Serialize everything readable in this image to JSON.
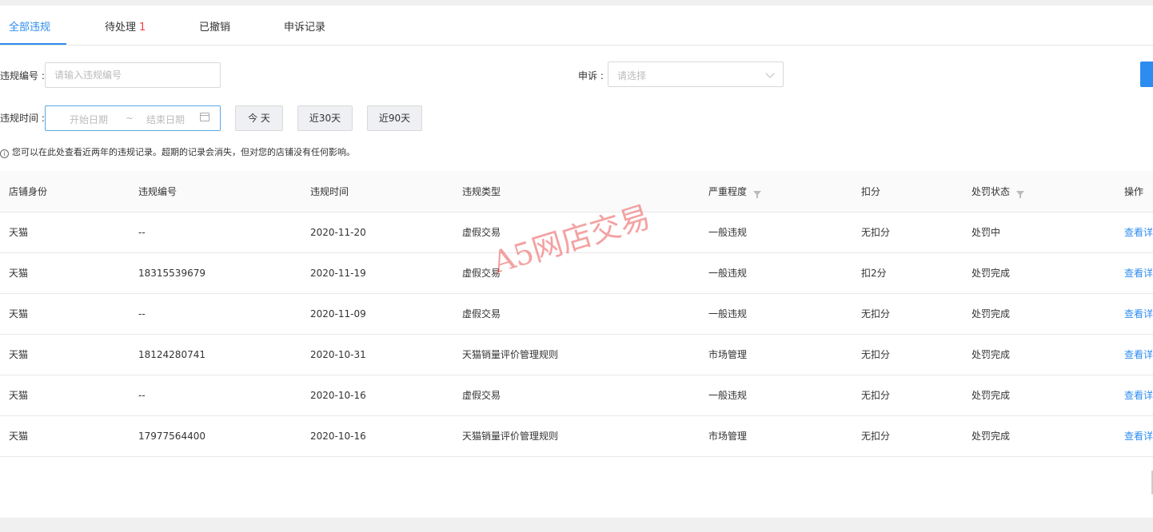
{
  "tabs": [
    {
      "label": "全部违规",
      "badge": ""
    },
    {
      "label": "待处理",
      "badge": "1"
    },
    {
      "label": "已撤销",
      "badge": ""
    },
    {
      "label": "申诉记录",
      "badge": ""
    }
  ],
  "filters": {
    "violation_no_label": "违规编号 :",
    "violation_no_placeholder": "请输入违规编号",
    "appeal_label": "申诉 :",
    "appeal_placeholder": "请选择",
    "time_label": "违规时间 :",
    "start_placeholder": "开始日期",
    "range_separator": "~",
    "end_placeholder": "结束日期",
    "quick": {
      "today": "今 天",
      "last30": "近30天",
      "last90": "近90天"
    }
  },
  "tip": "您可以在此处查看近两年的违规记录。超期的记录会消失，但对您的店铺没有任何影响。",
  "table": {
    "columns": [
      "店铺身份",
      "违规编号",
      "违规时间",
      "违规类型",
      "严重程度",
      "扣分",
      "处罚状态",
      "操作"
    ],
    "rows": [
      {
        "shop": "天猫",
        "no": "--",
        "time": "2020-11-20",
        "type": "虚假交易",
        "level": "一般违规",
        "points": "无扣分",
        "status": "处罚中",
        "action": "查看详"
      },
      {
        "shop": "天猫",
        "no": "18315539679",
        "time": "2020-11-19",
        "type": "虚假交易",
        "level": "一般违规",
        "points": "扣2分",
        "status": "处罚完成",
        "action": "查看详"
      },
      {
        "shop": "天猫",
        "no": "--",
        "time": "2020-11-09",
        "type": "虚假交易",
        "level": "一般违规",
        "points": "无扣分",
        "status": "处罚完成",
        "action": "查看详"
      },
      {
        "shop": "天猫",
        "no": "18124280741",
        "time": "2020-10-31",
        "type": "天猫销量评价管理规则",
        "level": "市场管理",
        "points": "无扣分",
        "status": "处罚完成",
        "action": "查看详"
      },
      {
        "shop": "天猫",
        "no": "--",
        "time": "2020-10-16",
        "type": "虚假交易",
        "level": "一般违规",
        "points": "无扣分",
        "status": "处罚完成",
        "action": "查看详"
      },
      {
        "shop": "天猫",
        "no": "17977564400",
        "time": "2020-10-16",
        "type": "天猫销量评价管理规则",
        "level": "市场管理",
        "points": "无扣分",
        "status": "处罚完成",
        "action": "查看详"
      }
    ]
  },
  "watermark": "A5网店交易",
  "colors": {
    "accent": "#2d8cf0",
    "badge": "#f23f3f"
  },
  "icons": {
    "info": "info-circle-icon",
    "calendar": "calendar-icon",
    "filter": "filter-icon",
    "chevron": "chevron-down-icon"
  }
}
